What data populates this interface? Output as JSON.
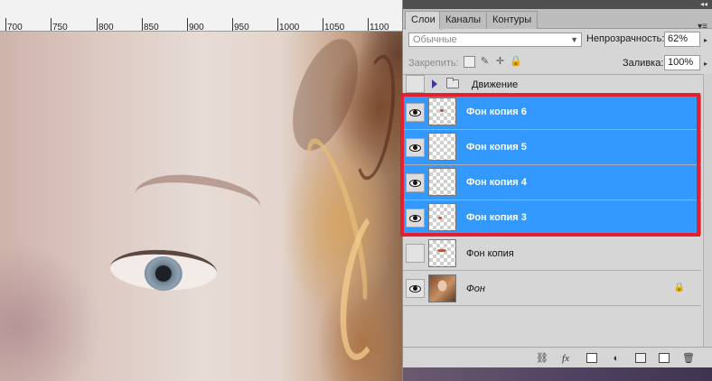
{
  "ruler": {
    "ticks": [
      "700",
      "750",
      "800",
      "850",
      "900",
      "950",
      "1000",
      "1050",
      "1100"
    ]
  },
  "panel": {
    "tabs": [
      {
        "label": "Слои",
        "active": true
      },
      {
        "label": "Каналы",
        "active": false
      },
      {
        "label": "Контуры",
        "active": false
      }
    ],
    "blend_mode": "Обычные",
    "opacity_label": "Непрозрачность:",
    "opacity_value": "62%",
    "lock_label": "Закрепить:",
    "fill_label": "Заливка:",
    "fill_value": "100%",
    "layers": [
      {
        "name": "Движение",
        "type": "group",
        "visible": false,
        "selected": false
      },
      {
        "name": "Фон копия 6",
        "type": "layer",
        "visible": true,
        "selected": true
      },
      {
        "name": "Фон копия 5",
        "type": "layer",
        "visible": true,
        "selected": true
      },
      {
        "name": "Фон копия 4",
        "type": "layer",
        "visible": true,
        "selected": true
      },
      {
        "name": "Фон копия 3",
        "type": "layer",
        "visible": true,
        "selected": true
      },
      {
        "name": "Фон копия",
        "type": "layer",
        "visible": false,
        "selected": false
      },
      {
        "name": "Фон",
        "type": "background",
        "visible": true,
        "selected": false,
        "locked": true
      }
    ],
    "bottom_icons": [
      "link-icon",
      "fx-icon",
      "mask-icon",
      "adjustment-icon",
      "group-folder-icon",
      "new-layer-icon",
      "trash-icon"
    ]
  },
  "colors": {
    "selection": "#3399ff",
    "highlight": "#e5202e"
  }
}
